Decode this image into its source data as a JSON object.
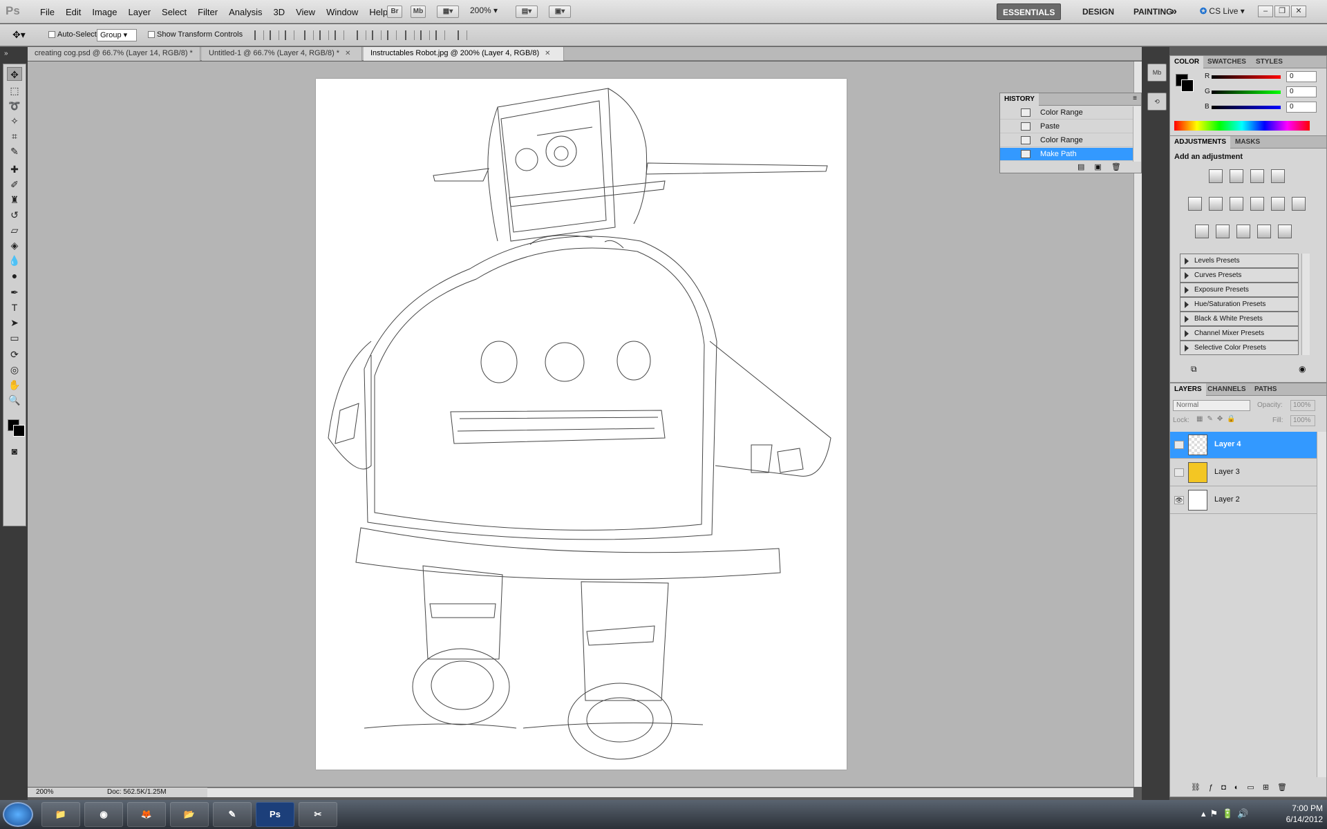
{
  "app": {
    "logo": "Ps"
  },
  "menu": [
    "File",
    "Edit",
    "Image",
    "Layer",
    "Select",
    "Filter",
    "Analysis",
    "3D",
    "View",
    "Window",
    "Help"
  ],
  "appbar": {
    "bridge": "Br",
    "minibridge": "Mb",
    "zoom": "200%"
  },
  "workspaces": {
    "essentials": "ESSENTIALS",
    "design": "DESIGN",
    "painting": "PAINTING",
    "more": "»",
    "cslive": "CS Live ▾"
  },
  "window_controls": {
    "minimize": "–",
    "restore": "❐",
    "close": "✕"
  },
  "options": {
    "auto_select_label": "Auto-Select:",
    "auto_select_value": "Group",
    "transform_label": "Show Transform Controls"
  },
  "tabs": [
    {
      "label": "creating cog.psd @ 66.7% (Layer 14, RGB/8) *"
    },
    {
      "label": "Untitled-1 @ 66.7% (Layer 4, RGB/8) *"
    },
    {
      "label": "Instructables Robot.jpg @ 200% (Layer 4, RGB/8)"
    }
  ],
  "status": {
    "zoom": "200%",
    "docsize": "Doc: 562.5K/1.25M"
  },
  "history": {
    "title": "HISTORY",
    "items": [
      {
        "label": "Color Range"
      },
      {
        "label": "Paste"
      },
      {
        "label": "Color Range"
      },
      {
        "label": "Make Path"
      }
    ]
  },
  "color_panel": {
    "tabs": [
      "COLOR",
      "SWATCHES",
      "STYLES"
    ],
    "r_label": "R",
    "g_label": "G",
    "b_label": "B",
    "r": "0",
    "g": "0",
    "b": "0",
    "colors": {
      "r": "#e00000",
      "g": "#00b000",
      "b": "#0000e0"
    }
  },
  "adjustments": {
    "tabs": [
      "ADJUSTMENTS",
      "MASKS"
    ],
    "heading": "Add an adjustment",
    "presets": [
      "Levels Presets",
      "Curves Presets",
      "Exposure Presets",
      "Hue/Saturation Presets",
      "Black & White Presets",
      "Channel Mixer Presets",
      "Selective Color Presets"
    ]
  },
  "layers_panel": {
    "tabs": [
      "LAYERS",
      "CHANNELS",
      "PATHS"
    ],
    "blend": "Normal",
    "opacity_label": "Opacity:",
    "opacity": "100%",
    "lock_label": "Lock:",
    "fill_label": "Fill:",
    "fill": "100%",
    "layers": [
      {
        "name": "Layer 4"
      },
      {
        "name": "Layer 3"
      },
      {
        "name": "Layer 2"
      }
    ]
  },
  "taskbar": {
    "ps_label": "Ps",
    "time": "7:00 PM",
    "date": "6/14/2012"
  },
  "accent": "#3399ff"
}
